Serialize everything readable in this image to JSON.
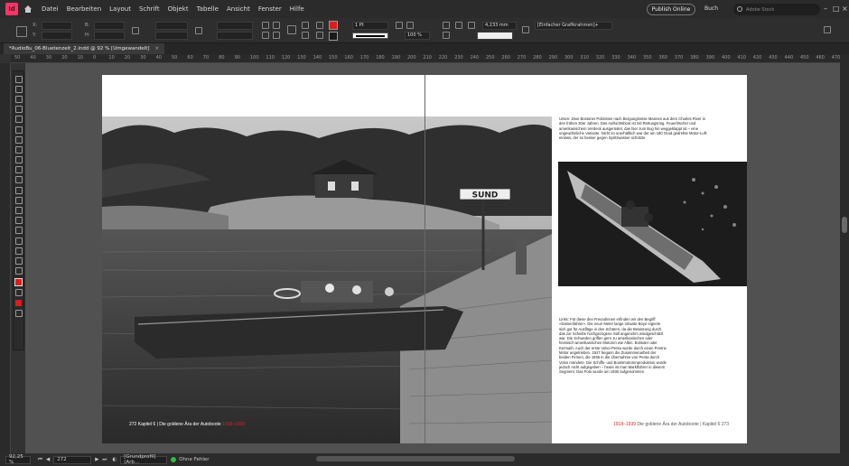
{
  "app": {
    "logo": "Id"
  },
  "menu": [
    "Datei",
    "Bearbeiten",
    "Layout",
    "Schrift",
    "Objekt",
    "Tabelle",
    "Ansicht",
    "Fenster",
    "Hilfe"
  ],
  "top_right": {
    "publish": "Publish Online",
    "workspace": "Buch",
    "search_placeholder": "Adobe Stock"
  },
  "control": {
    "stroke_weight": "1 Pt",
    "zoom": "100 %",
    "size": "4,233 mm",
    "object_style": "[Einfacher Grafikrahmen]+",
    "x_label": "X:",
    "y_label": "Y:",
    "w_label": "B:",
    "h_label": "H:"
  },
  "tab": {
    "title": "*AudioBu_06-Bluetenzeit_2.indd @ 92 % [Umgewandelt]"
  },
  "ruler_ticks": [
    "50",
    "40",
    "30",
    "20",
    "10",
    "0",
    "10",
    "20",
    "30",
    "40",
    "50",
    "60",
    "70",
    "80",
    "90",
    "100",
    "110",
    "120",
    "130",
    "140",
    "150",
    "160",
    "170",
    "180",
    "190",
    "200",
    "210",
    "220",
    "230",
    "240",
    "250",
    "260",
    "270",
    "280",
    "290",
    "300",
    "310",
    "320",
    "330",
    "340",
    "350",
    "360",
    "370",
    "380",
    "390",
    "400",
    "410",
    "420",
    "430",
    "440",
    "450",
    "460",
    "470"
  ],
  "spread": {
    "sign": "SUND",
    "caption_top": "Unten: Zwei Bostoner Polizisten nach Bergungsreise Mannes aus dem Charles River in den frühen 30er Jahren. Das Aufsichtsboot ist mit Rettungsring, Feuerlöscher und amerikanischem Verdeck ausgerüstet, das hier zum Bug hin weggeklappt ist – eine ungewöhnliche Variante. Nicht so unerhältlich war der um 180 Grad gedrehte Motor-Luft-einlass, der so besser gegen Spritzwasser schützte",
    "caption_bottom": "Links: Für diese drei Freundinnen erfinden wir den Begriff »Damenfahrer«. Die neun Meter lange robuste Boye eignete sich gut für Ausflüge in den Schären, da die Besatzung durch das zur Scheibe hochgezogene Süll angenehm windgeschützt war. Die Schweden griffen gern zu amerikanischen oder heimisch-amerikanischen Motoren wie Albin. Bolinder oder Kermath. Auch der erste Volvo-Penta wurde durch einen Pentra-Motor angetrieben. 1927 begann die Zusammenarbeit der beiden Firmen, die 1935 in die Übernahme von Penta durch Volvo mündete. Die Schiffs- und Bootsmotorenproduktion wurde jedoch nicht aufgegeben – heute ist man Marktführer in diesem Segment. Das Foto wurde um 1930 aufgenommen",
    "folio_left_num": "272",
    "folio_left_text": "Kapitel 6 | Die goldene Ära der Autoboote",
    "folio_left_years": "1918–1939",
    "folio_right_years": "1918–1939",
    "folio_right_text": "Die goldene Ära der Autoboote | Kapitel 6",
    "folio_right_num": "273"
  },
  "status": {
    "zoom": "92,25 %",
    "page": "272",
    "profile": "[Grundprofil] (Arb...",
    "errors": "Ohne Fehler"
  },
  "colors": {
    "accent": "#ff3366",
    "fill": "#e01b1b",
    "ok": "#2bbf3b"
  }
}
